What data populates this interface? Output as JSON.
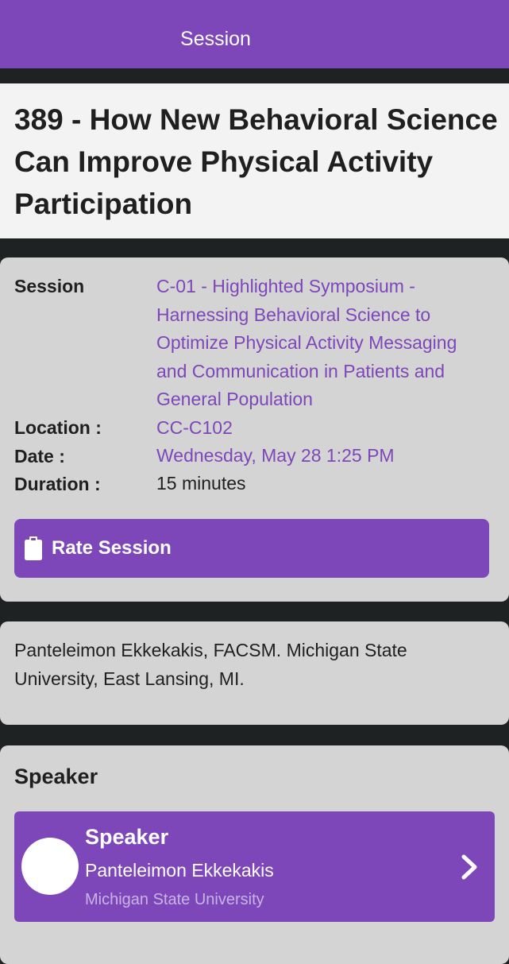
{
  "header": {
    "title": "Session"
  },
  "session": {
    "title": "389 - How New Behavioral Science Can Improve Physical Activity Participation"
  },
  "details": {
    "session_label": "Session",
    "session_value": "C-01 - Highlighted Symposium - Harnessing Behavioral Science to Optimize Physical Activity Messaging and Communication in Patients and General Population",
    "location_label": "Location :",
    "location_value": "CC-C102",
    "date_label": "Date :",
    "date_value": "Wednesday, May 28 1:25 PM",
    "duration_label": "Duration :",
    "duration_value": "15 minutes"
  },
  "rate_button": {
    "label": "Rate Session",
    "icon": "clipboard-icon"
  },
  "affiliation": {
    "text": "Panteleimon Ekkekakis, FACSM. Michigan State University, East Lansing, MI."
  },
  "speaker_section": {
    "heading": "Speaker",
    "card": {
      "role": "Speaker",
      "name": "Panteleimon Ekkekakis",
      "organization": "Michigan State University",
      "icon": "chevron-right-icon"
    }
  },
  "colors": {
    "accent": "#7d47b9",
    "background": "#1e2222",
    "card": "#d4d4d4",
    "title_card": "#f3f3f3"
  }
}
